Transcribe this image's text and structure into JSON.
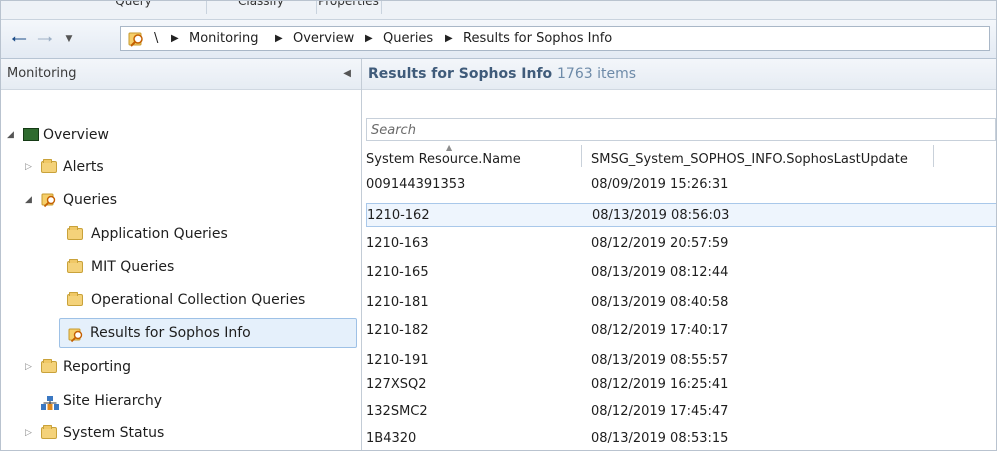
{
  "ribbon": {
    "tabs": [
      "Query",
      "Classify",
      "Properties"
    ]
  },
  "address_bar": {
    "root": "\\",
    "breadcrumbs": [
      "Monitoring",
      "Overview",
      "Queries",
      "Results for Sophos Info"
    ]
  },
  "left_pane": {
    "title": "Monitoring",
    "tree": [
      {
        "label": "Overview",
        "icon": "monitor-icon"
      },
      {
        "label": "Alerts",
        "icon": "folder-icon"
      },
      {
        "label": "Queries",
        "icon": "query-icon"
      },
      {
        "label": "Application Queries",
        "icon": "folder-icon"
      },
      {
        "label": "MIT Queries",
        "icon": "folder-icon"
      },
      {
        "label": "Operational Collection Queries",
        "icon": "folder-icon"
      },
      {
        "label": "Results for Sophos Info",
        "icon": "query-icon",
        "selected": true
      },
      {
        "label": "Reporting",
        "icon": "folder-icon"
      },
      {
        "label": "Site Hierarchy",
        "icon": "site-hierarchy-icon"
      },
      {
        "label": "System Status",
        "icon": "folder-icon"
      }
    ]
  },
  "right_pane": {
    "title": "Results for Sophos Info",
    "count": "1763 items",
    "search_placeholder": "Search",
    "columns": [
      "System Resource.Name",
      "SMSG_System_SOPHOS_INFO.SophosLastUpdate"
    ],
    "rows": [
      {
        "name": "009144391353",
        "last_update": "08/09/2019 15:26:31"
      },
      {
        "name": "1210-162",
        "last_update": "08/13/2019 08:56:03",
        "selected": true
      },
      {
        "name": "1210-163",
        "last_update": "08/12/2019 20:57:59"
      },
      {
        "name": "1210-165",
        "last_update": "08/13/2019 08:12:44"
      },
      {
        "name": "1210-181",
        "last_update": "08/13/2019 08:40:58"
      },
      {
        "name": "1210-182",
        "last_update": "08/12/2019 17:40:17"
      },
      {
        "name": "1210-191",
        "last_update": "08/13/2019 08:55:57"
      },
      {
        "name": "127XSQ2",
        "last_update": "08/12/2019 16:25:41"
      },
      {
        "name": "132SMC2",
        "last_update": "08/12/2019 17:45:47"
      },
      {
        "name": "1B4320",
        "last_update": "08/13/2019 08:53:15"
      }
    ]
  },
  "colors": {
    "selection_bg": "#e5f0fb",
    "selection_border": "#9ec1e6",
    "header_title": "#3f5b7a",
    "header_count": "#6d8aa8",
    "folder": "#f4d27a"
  }
}
